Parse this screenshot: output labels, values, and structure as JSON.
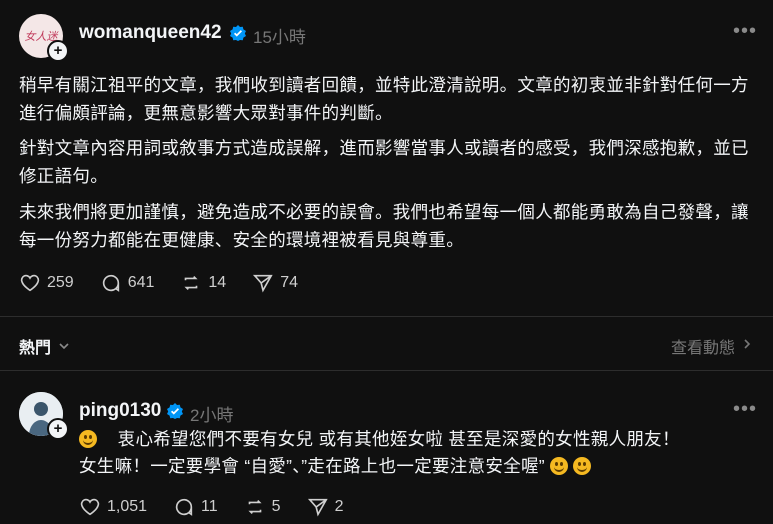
{
  "post": {
    "username": "womanqueen42",
    "time": "15小時",
    "avatar_text": "女人迷",
    "paragraphs": [
      "稍早有關江祖平的文章，我們收到讀者回饋，並特此澄清說明。文章的初衷並非針對任何一方進行偏頗評論，更無意影響大眾對事件的判斷。",
      "針對文章內容用詞或敘事方式造成誤解，進而影響當事人或讀者的感受，我們深感抱歉，並已修正語句。",
      "未來我們將更加謹慎，避免造成不必要的誤會。我們也希望每一個人都能勇敢為自己發聲，讓每一份努力都能在更健康、安全的環境裡被看見與尊重。"
    ],
    "likes": "259",
    "comments": "641",
    "reposts": "14",
    "shares": "74"
  },
  "sort": {
    "label": "熱門",
    "activity": "查看動態"
  },
  "reply": {
    "username": "ping0130",
    "time": "2小時",
    "line1": "衷心希望您們不要有女兒 或有其他姪女啦 甚至是深愛的女性親人朋友！",
    "line2": "女生嘛！一定要學會 “自愛”、”走在路上也一定要注意安全喔”",
    "likes": "1,051",
    "comments": "11",
    "reposts": "5",
    "shares": "2"
  },
  "colors": {
    "background": "#101010",
    "text": "#f3f5f7",
    "muted": "#777777",
    "verified": "#0095f6"
  }
}
